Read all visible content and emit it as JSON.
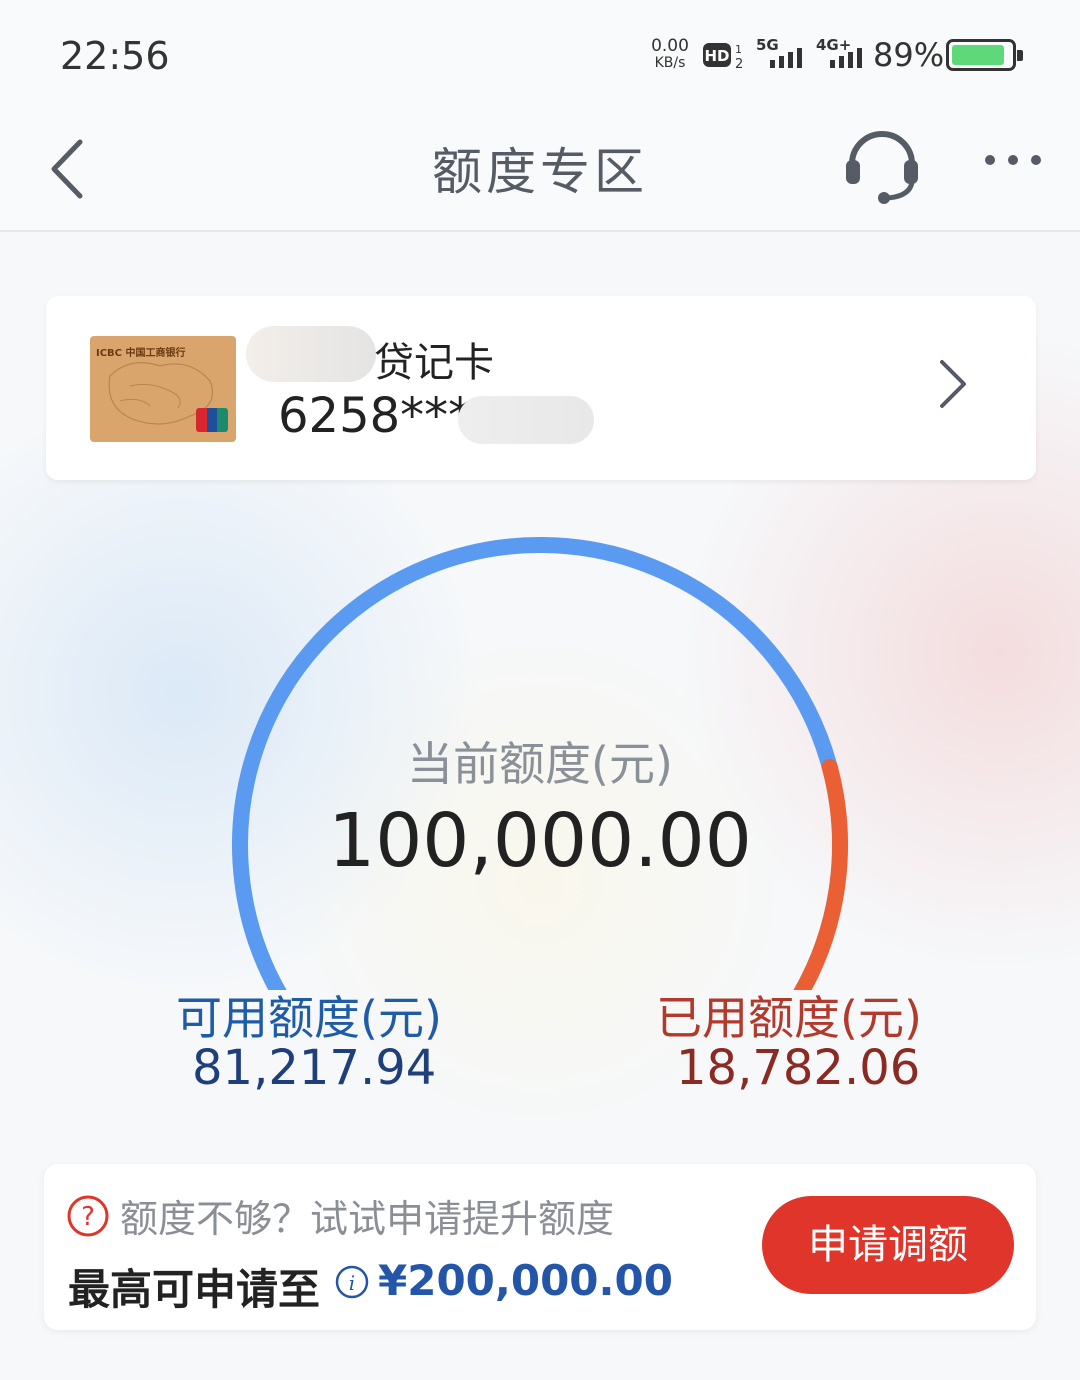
{
  "status_bar": {
    "time": "22:56",
    "net_speed_value": "0.00",
    "net_speed_unit": "KB/s",
    "hd_label": "HD",
    "signal_5g": "5G",
    "signal_4g": "4G+",
    "battery_percent": "89%",
    "battery_level": 0.89
  },
  "nav": {
    "title": "额度专区",
    "back_icon": "chevron-left",
    "service_icon": "headset",
    "more_icon": "ellipsis"
  },
  "card": {
    "bank_label": "ICBC 中国工商银行",
    "name_suffix": "贷记卡",
    "number_prefix": "6258***",
    "network_icon": "unionpay"
  },
  "gauge": {
    "label": "当前额度(元)",
    "value": "100,000.00",
    "total": 100000.0,
    "available": 81217.94,
    "used": 18782.06,
    "available_color": "#5a9af0",
    "used_color": "#ea5f34"
  },
  "available": {
    "label": "可用额度(元)",
    "value": "81,217.94"
  },
  "used": {
    "label": "已用额度(元)",
    "value": "18,782.06"
  },
  "promo": {
    "question_text": "额度不够？试试申请提升额度",
    "max_label": "最高可申请至",
    "max_value": "¥200,000.00",
    "button_label": "申请调额"
  }
}
